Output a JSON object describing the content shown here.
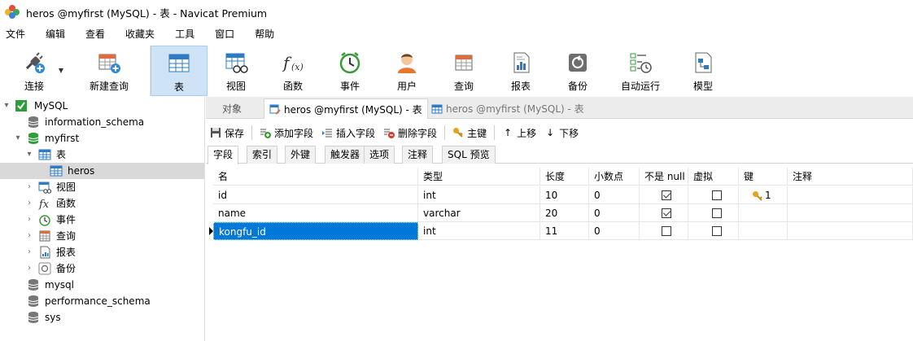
{
  "window": {
    "title": "heros @myfirst (MySQL) - 表 - Navicat Premium"
  },
  "menu": [
    "文件",
    "编辑",
    "查看",
    "收藏夹",
    "工具",
    "窗口",
    "帮助"
  ],
  "toolbar": {
    "connect": "连接",
    "new_query": "新建查询",
    "table": "表",
    "view": "视图",
    "function": "函数",
    "event": "事件",
    "user": "用户",
    "query": "查询",
    "report": "报表",
    "backup": "备份",
    "automation": "自动运行",
    "model": "模型"
  },
  "sidebar": {
    "connection": "MySQL",
    "db_information_schema": "information_schema",
    "db_myfirst": "myfirst",
    "tables": "表",
    "table_heros": "heros",
    "views": "视图",
    "functions": "函数",
    "events": "事件",
    "queries": "查询",
    "reports": "报表",
    "backups": "备份",
    "db_mysql": "mysql",
    "db_performance_schema": "performance_schema",
    "db_sys": "sys"
  },
  "tabs": {
    "objects": "对象",
    "active": "heros @myfirst (MySQL) - 表",
    "inactive": "heros @myfirst (MySQL) - 表"
  },
  "design_toolbar": {
    "save": "保存",
    "add_field": "添加字段",
    "insert_field": "插入字段",
    "delete_field": "删除字段",
    "primary_key": "主键",
    "move_up": "上移",
    "move_down": "下移"
  },
  "subtabs": [
    "字段",
    "索引",
    "外键",
    "触发器",
    "选项",
    "注释",
    "SQL 预览"
  ],
  "grid": {
    "headers": [
      "名",
      "类型",
      "长度",
      "小数点",
      "不是 null",
      "虚拟",
      "键",
      "注释"
    ],
    "rows": [
      {
        "name": "id",
        "type": "int",
        "length": "10",
        "decimals": "0",
        "not_null": true,
        "virtual": false,
        "key": "1",
        "comment": ""
      },
      {
        "name": "name",
        "type": "varchar",
        "length": "20",
        "decimals": "0",
        "not_null": true,
        "virtual": false,
        "key": "",
        "comment": ""
      },
      {
        "name": "kongfu_id",
        "type": "int",
        "length": "11",
        "decimals": "0",
        "not_null": false,
        "virtual": false,
        "key": "",
        "comment": ""
      }
    ]
  },
  "colors": {
    "selection": "#0078d7",
    "toolbar_active": "#cfe3f7"
  }
}
